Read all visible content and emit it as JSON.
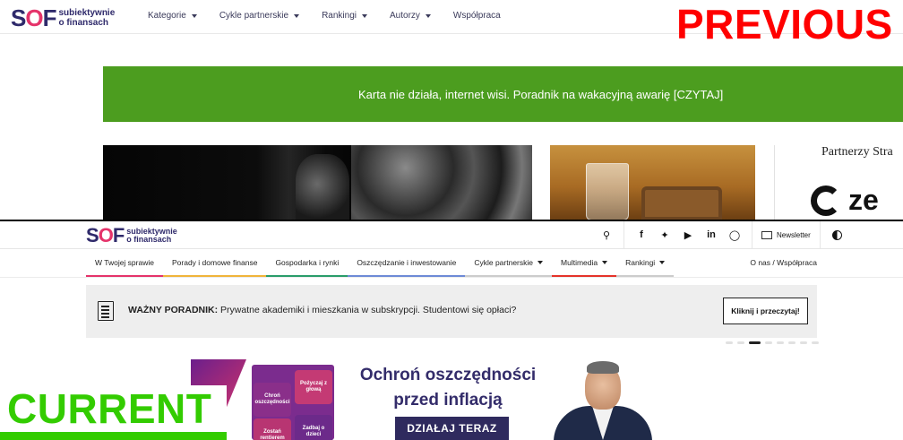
{
  "previous": {
    "label": "PREVIOUS",
    "logo": {
      "mark_s": "S",
      "mark_o": "O",
      "mark_f": "F",
      "line1": "subiektywnie",
      "line2": "o finansach"
    },
    "nav": [
      {
        "label": "Kategorie",
        "dropdown": true
      },
      {
        "label": "Cykle partnerskie",
        "dropdown": true
      },
      {
        "label": "Rankingi",
        "dropdown": true
      },
      {
        "label": "Autorzy",
        "dropdown": true
      },
      {
        "label": "Współpraca",
        "dropdown": false
      }
    ],
    "banner_text": "Karta nie działa, internet wisi. Poradnik na wakacyjną awarię [CZYTAJ]",
    "banner_color": "#4c9d1f",
    "partners_title": "Partnerzy Stra",
    "partner_logo_text": "ze"
  },
  "current": {
    "label": "CURRENT",
    "logo": {
      "mark_s": "S",
      "mark_o": "O",
      "mark_f": "F",
      "line1": "subiektywnie",
      "line2": "o finansach"
    },
    "toolbar": {
      "icons": [
        "search-icon",
        "facebook-icon",
        "twitter-icon",
        "youtube-icon",
        "linkedin-icon",
        "instagram-icon"
      ],
      "newsletter_label": "Newsletter"
    },
    "nav": [
      {
        "label": "W Twojej sprawie",
        "color": "#e5336a",
        "dropdown": false
      },
      {
        "label": "Porady i domowe finanse",
        "color": "#f0b43a",
        "dropdown": false
      },
      {
        "label": "Gospodarka i rynki",
        "color": "#2a9d6a",
        "dropdown": false
      },
      {
        "label": "Oszczędzanie i inwestowanie",
        "color": "#6e8ad6",
        "dropdown": false
      },
      {
        "label": "Cykle partnerskie",
        "color": "#cccccc",
        "dropdown": true
      },
      {
        "label": "Multimedia",
        "color": "#e5332a",
        "dropdown": true
      },
      {
        "label": "Rankingi",
        "color": "#cccccc",
        "dropdown": true
      }
    ],
    "about_link": "O nas / Współpraca",
    "important": {
      "prefix": "WAŻNY PORADNIK:",
      "text": " Prywatne akademiki i mieszkania w subskrypcji. Studentowi się opłaci?",
      "cta": "Kliknij i przeczytaj!"
    },
    "carousel": {
      "count": 8,
      "active": 3
    },
    "ad": {
      "headline_line1": "Ochroń oszczędności",
      "headline_line2": "przed inflacją",
      "button": "DZIAŁAJ TERAZ",
      "puzzle": [
        "Chroń oszczędności",
        "Pożyczaj z głową",
        "Zostań rentierem",
        "Zadbaj o dzieci"
      ]
    }
  }
}
